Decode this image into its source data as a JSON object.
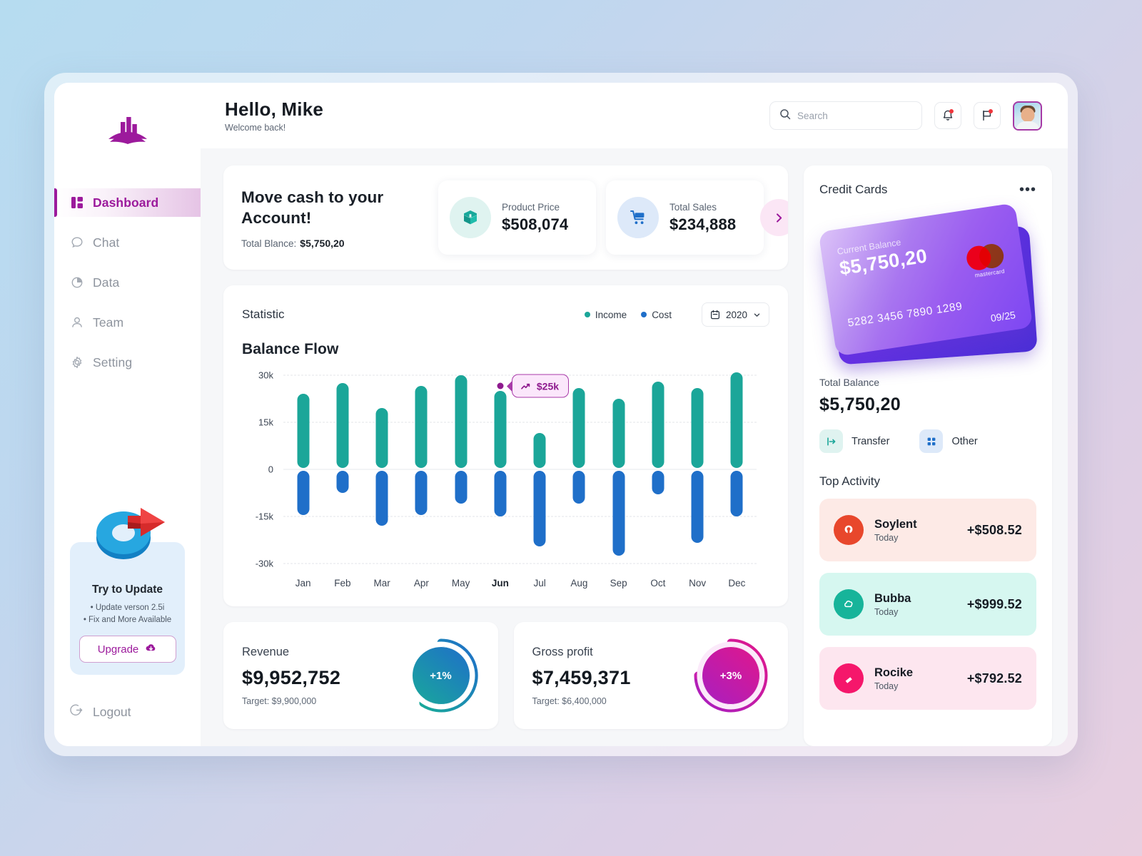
{
  "brand": {
    "logo_icon": "book-chart-logo",
    "color": "#9c1a9c"
  },
  "sidebar": {
    "items": [
      {
        "label": "Dashboard",
        "icon": "dashboard-grid-icon",
        "active": true
      },
      {
        "label": "Chat",
        "icon": "chat-bubble-icon",
        "active": false
      },
      {
        "label": "Data",
        "icon": "pie-chart-icon",
        "active": false
      },
      {
        "label": "Team",
        "icon": "user-icon",
        "active": false
      },
      {
        "label": "Setting",
        "icon": "gear-icon",
        "active": false
      }
    ],
    "promo": {
      "art_icon": "update-arrow-3d-icon",
      "title": "Try to Update",
      "line1": "• Update verson 2.5i",
      "line2": "• Fix and More Available",
      "button": "Upgrade",
      "button_icon": "cloud-download-icon"
    },
    "logout": {
      "label": "Logout",
      "icon": "logout-icon"
    }
  },
  "header": {
    "title": "Hello, Mike",
    "subtitle": "Welcome back!",
    "search": {
      "placeholder": "Search",
      "value": "",
      "icon": "search-icon"
    },
    "notification_icon": "bell-icon",
    "message_icon": "message-flag-icon",
    "avatar_icon": "user-avatar"
  },
  "cash_card": {
    "title": "Move cash to your Account!",
    "balance_label": "Total Blance:",
    "balance_value": "$5,750,20",
    "next_icon": "chevron-right-icon",
    "stats": [
      {
        "label": "Product Price",
        "value": "$508,074",
        "icon": "package-box-icon",
        "icon_bg": "#dff3f0",
        "icon_color": "#1ba699"
      },
      {
        "label": "Total Sales",
        "value": "$234,888",
        "icon": "shopping-cart-icon",
        "icon_bg": "#dde9f9",
        "icon_color": "#1f6fc9"
      }
    ]
  },
  "statistic": {
    "title": "Statistic",
    "legend": [
      {
        "label": "Income",
        "color": "#1ba699"
      },
      {
        "label": "Cost",
        "color": "#1f6fc9"
      }
    ],
    "year_select": {
      "value": "2020",
      "icon": "calendar-icon",
      "chevron": "chevron-down-icon"
    },
    "chart_title": "Balance Flow"
  },
  "chart_data": {
    "type": "bar",
    "title": "Balance Flow",
    "subtitle": "Statistic",
    "xlabel": "",
    "ylabel": "",
    "ylim": [
      -30,
      30
    ],
    "ytick_labels": [
      "30k",
      "15k",
      "0",
      "-15k",
      "-30k"
    ],
    "ytick_values": [
      30,
      15,
      0,
      -15,
      -30
    ],
    "grid": true,
    "legend_position": "top-right",
    "unit": "k",
    "categories": [
      "Jan",
      "Feb",
      "Mar",
      "Apr",
      "May",
      "Jun",
      "Jul",
      "Aug",
      "Sep",
      "Oct",
      "Nov",
      "Dec"
    ],
    "highlighted_category": "Jun",
    "series": [
      {
        "name": "Income",
        "color": "#1ba699",
        "values": [
          24,
          27.5,
          19.5,
          26.5,
          30,
          25,
          11.5,
          26,
          22.5,
          28,
          26,
          31
        ]
      },
      {
        "name": "Cost",
        "color": "#1f6fc9",
        "values": [
          -14.5,
          -7.5,
          -18,
          -14.5,
          -11,
          -15,
          -24.5,
          -11,
          -27.5,
          -8,
          -23.5,
          -15
        ]
      }
    ],
    "annotation": {
      "category": "Jun",
      "label": "$25k",
      "value": 25,
      "icon": "trend-up-icon",
      "color": "#8e1a8e"
    }
  },
  "kpis": [
    {
      "label": "Revenue",
      "value": "$9,952,752",
      "target": "Target: $9,900,000",
      "badge": "+1%",
      "ring_from": "#19a89b",
      "ring_to": "#1f6fc9",
      "percent": 1
    },
    {
      "label": "Gross profit",
      "value": "$7,459,371",
      "target": "Target: $6,400,000",
      "badge": "+3%",
      "ring_from": "#a81fc0",
      "ring_to": "#e0178c",
      "percent": 3
    }
  ],
  "credit_cards": {
    "title": "Credit Cards",
    "more_icon": "more-horizontal-icon",
    "card": {
      "balance_label": "Current Balance",
      "balance_value": "$5,750,20",
      "number": "5282 3456 7890 1289",
      "expiry": "09/25",
      "network": "mastercard",
      "network_icon": "mastercard-logo"
    }
  },
  "total_balance": {
    "label": "Total Balance",
    "value": "$5,750,20",
    "actions": [
      {
        "label": "Transfer",
        "icon": "transfer-arrow-icon",
        "bg": "#dff3f0",
        "color": "#1ba699"
      },
      {
        "label": "Other",
        "icon": "grid-dots-icon",
        "bg": "#dde9f9",
        "color": "#1f6fc9"
      }
    ]
  },
  "top_activity": {
    "title": "Top Activity",
    "items": [
      {
        "name": "Soylent",
        "time": "Today",
        "amount": "+$508.52",
        "bg": "#fdeae6",
        "avatar_bg": "#e8472c",
        "icon": "soylent-logo"
      },
      {
        "name": "Bubba",
        "time": "Today",
        "amount": "+$999.52",
        "bg": "#d6f7f0",
        "avatar_bg": "#17b49a",
        "icon": "bubba-cloud-logo"
      },
      {
        "name": "Rocike",
        "time": "Today",
        "amount": "+$792.52",
        "bg": "#fde6ef",
        "avatar_bg": "#f5176b",
        "icon": "rocike-logo"
      }
    ]
  }
}
